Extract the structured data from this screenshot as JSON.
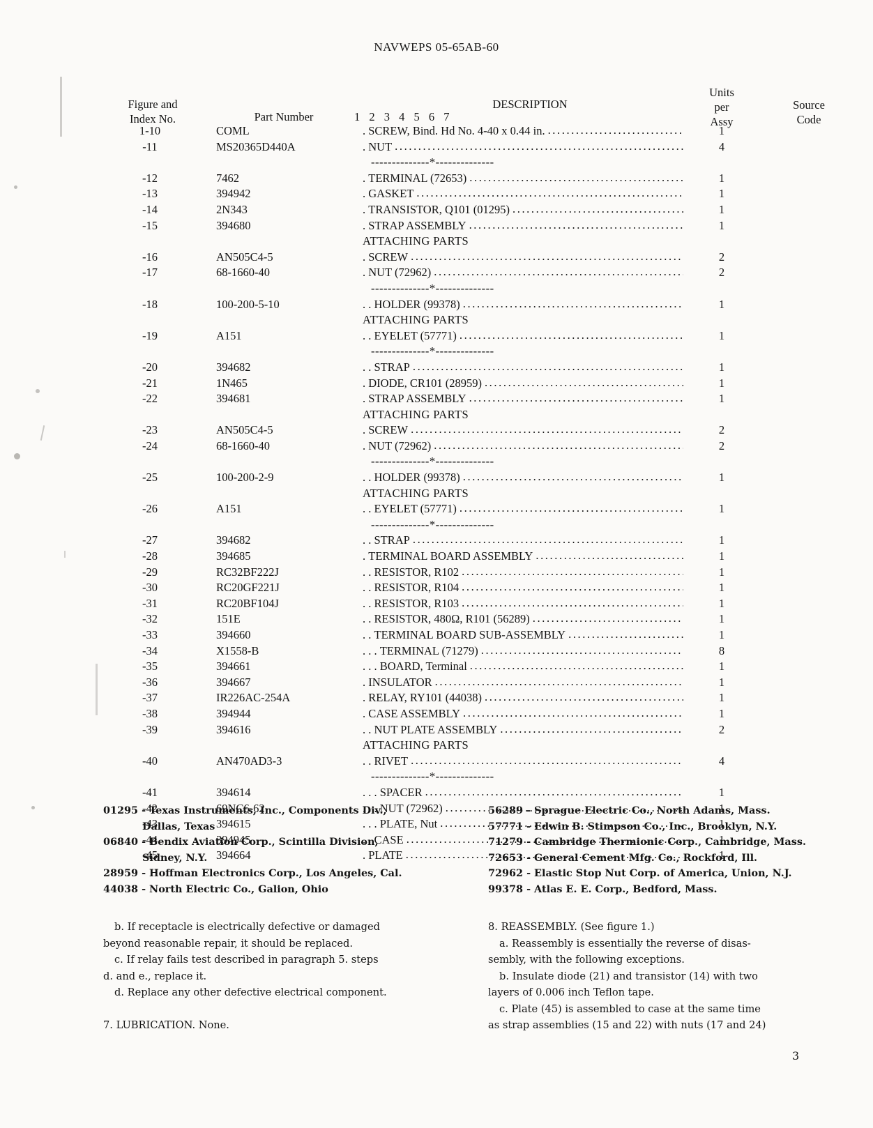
{
  "document": {
    "header": "NAVWEPS 05-65AB-60",
    "page_number": "3"
  },
  "table": {
    "columns": {
      "figure_line1": "Figure and",
      "figure_line2": "Index No.",
      "part_number": "Part Number",
      "description": "DESCRIPTION",
      "indent_scale": "1  2  3  4  5  6  7",
      "units_line1": "Units",
      "units_line2": "per",
      "units_line3": "Assy",
      "source_line1": "Source",
      "source_line2": "Code"
    },
    "separator": "--------------*--------------",
    "attaching_parts_label": "ATTACHING PARTS",
    "rows": [
      {
        "kind": "item",
        "index": "1-10",
        "part": "COML",
        "indent": ". ",
        "desc": "SCREW, Bind. Hd No. 4-40 x 0.44 in.",
        "units": "1",
        "source": ""
      },
      {
        "kind": "item",
        "index": "-11",
        "part": "MS20365D440A",
        "indent": ". ",
        "desc": "NUT",
        "units": "4",
        "source": ""
      },
      {
        "kind": "sep"
      },
      {
        "kind": "item",
        "index": "-12",
        "part": "7462",
        "indent": ". ",
        "desc": "TERMINAL (72653)",
        "units": "1",
        "source": ""
      },
      {
        "kind": "item",
        "index": "-13",
        "part": "394942",
        "indent": ". ",
        "desc": "GASKET",
        "units": "1",
        "source": ""
      },
      {
        "kind": "item",
        "index": "-14",
        "part": "2N343",
        "indent": ". ",
        "desc": "TRANSISTOR, Q101 (01295)",
        "units": "1",
        "source": ""
      },
      {
        "kind": "item",
        "index": "-15",
        "part": "394680",
        "indent": ". ",
        "desc": "STRAP ASSEMBLY",
        "units": "1",
        "source": ""
      },
      {
        "kind": "attach"
      },
      {
        "kind": "item",
        "index": "-16",
        "part": "AN505C4-5",
        "indent": ". ",
        "desc": "SCREW",
        "units": "2",
        "source": ""
      },
      {
        "kind": "item",
        "index": "-17",
        "part": "68-1660-40",
        "indent": ". ",
        "desc": "NUT (72962)",
        "units": "2",
        "source": ""
      },
      {
        "kind": "sep"
      },
      {
        "kind": "item",
        "index": "-18",
        "part": "100-200-5-10",
        "indent": ". . ",
        "desc": "HOLDER (99378)",
        "units": "1",
        "source": ""
      },
      {
        "kind": "attach"
      },
      {
        "kind": "item",
        "index": "-19",
        "part": "A151",
        "indent": ". . ",
        "desc": "EYELET (57771)",
        "units": "1",
        "source": ""
      },
      {
        "kind": "sep"
      },
      {
        "kind": "item",
        "index": "-20",
        "part": "394682",
        "indent": ". . ",
        "desc": "STRAP",
        "units": "1",
        "source": ""
      },
      {
        "kind": "item",
        "index": "-21",
        "part": "1N465",
        "indent": ". ",
        "desc": "DIODE, CR101 (28959)",
        "units": "1",
        "source": ""
      },
      {
        "kind": "item",
        "index": "-22",
        "part": "394681",
        "indent": ". ",
        "desc": "STRAP ASSEMBLY",
        "units": "1",
        "source": ""
      },
      {
        "kind": "attach"
      },
      {
        "kind": "item",
        "index": "-23",
        "part": "AN505C4-5",
        "indent": ". ",
        "desc": "SCREW",
        "units": "2",
        "source": ""
      },
      {
        "kind": "item",
        "index": "-24",
        "part": "68-1660-40",
        "indent": ". ",
        "desc": "NUT (72962)",
        "units": "2",
        "source": ""
      },
      {
        "kind": "sep"
      },
      {
        "kind": "item",
        "index": "-25",
        "part": "100-200-2-9",
        "indent": ". . ",
        "desc": "HOLDER (99378)",
        "units": "1",
        "source": ""
      },
      {
        "kind": "attach"
      },
      {
        "kind": "item",
        "index": "-26",
        "part": "A151",
        "indent": ". . ",
        "desc": "EYELET (57771)",
        "units": "1",
        "source": ""
      },
      {
        "kind": "sep"
      },
      {
        "kind": "item",
        "index": "-27",
        "part": "394682",
        "indent": ". . ",
        "desc": "STRAP",
        "units": "1",
        "source": ""
      },
      {
        "kind": "item",
        "index": "-28",
        "part": "394685",
        "indent": ". ",
        "desc": "TERMINAL BOARD ASSEMBLY",
        "units": "1",
        "source": ""
      },
      {
        "kind": "item",
        "index": "-29",
        "part": "RC32BF222J",
        "indent": ". . ",
        "desc": "RESISTOR, R102",
        "units": "1",
        "source": ""
      },
      {
        "kind": "item",
        "index": "-30",
        "part": "RC20GF221J",
        "indent": ". . ",
        "desc": "RESISTOR, R104",
        "units": "1",
        "source": ""
      },
      {
        "kind": "item",
        "index": "-31",
        "part": "RC20BF104J",
        "indent": ". . ",
        "desc": "RESISTOR, R103",
        "units": "1",
        "source": ""
      },
      {
        "kind": "item",
        "index": "-32",
        "part": "151E",
        "indent": ". . ",
        "desc": "RESISTOR, 480Ω, R101 (56289)",
        "units": "1",
        "source": ""
      },
      {
        "kind": "item",
        "index": "-33",
        "part": "394660",
        "indent": ". . ",
        "desc": "TERMINAL BOARD SUB-ASSEMBLY",
        "units": "1",
        "source": ""
      },
      {
        "kind": "item",
        "index": "-34",
        "part": "X1558-B",
        "indent": ". . . ",
        "desc": "TERMINAL (71279)",
        "units": "8",
        "source": ""
      },
      {
        "kind": "item",
        "index": "-35",
        "part": "394661",
        "indent": ". . . ",
        "desc": "BOARD, Terminal",
        "units": "1",
        "source": ""
      },
      {
        "kind": "item",
        "index": "-36",
        "part": "394667",
        "indent": ". ",
        "desc": "INSULATOR",
        "units": "1",
        "source": ""
      },
      {
        "kind": "item",
        "index": "-37",
        "part": "IR226AC-254A",
        "indent": ". ",
        "desc": "RELAY, RY101 (44038)",
        "units": "1",
        "source": ""
      },
      {
        "kind": "item",
        "index": "-38",
        "part": "394944",
        "indent": ". ",
        "desc": "CASE ASSEMBLY",
        "units": "1",
        "source": ""
      },
      {
        "kind": "item",
        "index": "-39",
        "part": "394616",
        "indent": ". . ",
        "desc": "NUT PLATE ASSEMBLY",
        "units": "2",
        "source": ""
      },
      {
        "kind": "attach"
      },
      {
        "kind": "item",
        "index": "-40",
        "part": "AN470AD3-3",
        "indent": ". . ",
        "desc": "RIVET",
        "units": "4",
        "source": ""
      },
      {
        "kind": "sep"
      },
      {
        "kind": "item",
        "index": "-41",
        "part": "394614",
        "indent": ". . . ",
        "desc": "SPACER",
        "units": "1",
        "source": ""
      },
      {
        "kind": "item",
        "index": "-42",
        "part": "69NC6-62",
        "indent": ". . . ",
        "desc": "NUT (72962)",
        "units": "1",
        "source": ""
      },
      {
        "kind": "item",
        "index": "-43",
        "part": "394615",
        "indent": ". . . ",
        "desc": "PLATE, Nut",
        "units": "1",
        "source": ""
      },
      {
        "kind": "item",
        "index": "-44",
        "part": "394945",
        "indent": ". . ",
        "desc": "CASE",
        "units": "1",
        "source": ""
      },
      {
        "kind": "item",
        "index": "-45",
        "part": "394664",
        "indent": ". ",
        "desc": "PLATE",
        "units": "1",
        "source": ""
      }
    ]
  },
  "vendor_codes": {
    "left": [
      {
        "text": "01295 - Texas Instruments, Inc., Components Div.,",
        "cont": false
      },
      {
        "text": "Dallas,  Texas",
        "cont": true
      },
      {
        "text": "06840 - Bendix Aviation Corp., Scintilla Division,",
        "cont": false
      },
      {
        "text": "Sidney,  N.Y.",
        "cont": true
      },
      {
        "text": "28959 - Hoffman Electronics Corp., Los Angeles, Cal.",
        "cont": false
      },
      {
        "text": "44038 - North Electric Co., Galion, Ohio",
        "cont": false
      }
    ],
    "right": [
      {
        "text": "56289 - Sprague Electric Co., North Adams, Mass.",
        "cont": false
      },
      {
        "text": "57771 - Edwin B. Stimpson Co., Inc., Brooklyn, N.Y.",
        "cont": false
      },
      {
        "text": "71279 - Cambridge Thermionic Corp., Cambridge, Mass.",
        "cont": false
      },
      {
        "text": "72653 - General Cement Mfg. Co., Rockford, Ill.",
        "cont": false
      },
      {
        "text": "72962 - Elastic Stop Nut Corp. of America, Union, N.J.",
        "cont": false
      },
      {
        "text": "99378 - Atlas E. E. Corp., Bedford, Mass.",
        "cont": false
      }
    ]
  },
  "body": {
    "left": [
      {
        "text": "b.  If receptacle is electrically defective or damaged",
        "indent": true
      },
      {
        "text": "beyond reasonable repair, it should be replaced.",
        "indent": false
      },
      {
        "text": "c.  If relay fails test described in paragraph 5. steps",
        "indent": true
      },
      {
        "text": "d. and e., replace it.",
        "indent": false
      },
      {
        "text": "d.  Replace any other defective electrical component.",
        "indent": true
      },
      {
        "text": "",
        "indent": false
      },
      {
        "text": "7.  LUBRICATION.  None.",
        "indent": false
      }
    ],
    "right": [
      {
        "text": "8.  REASSEMBLY.  (See figure 1.)",
        "indent": false
      },
      {
        "text": "a.  Reassembly is essentially the reverse of disas-",
        "indent": true
      },
      {
        "text": "sembly, with the following exceptions.",
        "indent": false
      },
      {
        "text": "b.  Insulate diode (21) and transistor (14) with two",
        "indent": true
      },
      {
        "text": "layers of 0.006 inch Teflon tape.",
        "indent": false
      },
      {
        "text": "c.  Plate (45) is assembled to case at the same time",
        "indent": true
      },
      {
        "text": "as strap assemblies (15 and 22) with nuts (17 and 24)",
        "indent": false
      }
    ]
  }
}
